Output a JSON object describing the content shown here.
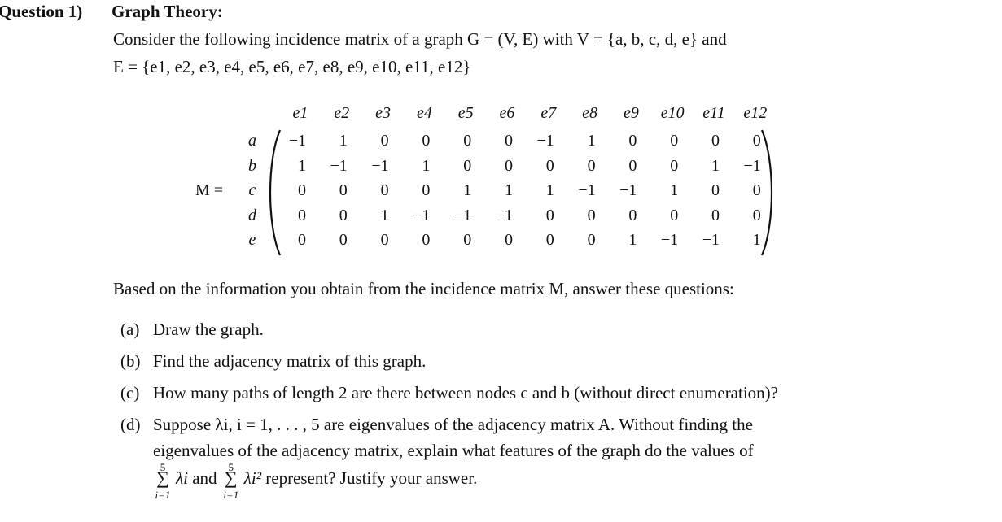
{
  "question": {
    "number": "Question 1)",
    "title": "Graph Theory:"
  },
  "intro": {
    "line1": "Consider the following incidence matrix of a graph G = (V, E) with V = {a, b, c, d, e} and",
    "line2": "E = {e1, e2, e3, e4, e5, e6, e7, e8, e9, e10, e11, e12}",
    "after_matrix": "Based on the information you obtain from the incidence matrix M, answer these questions:"
  },
  "matrix": {
    "name": "M =",
    "columns": [
      "e1",
      "e2",
      "e3",
      "e4",
      "e5",
      "e6",
      "e7",
      "e8",
      "e9",
      "e10",
      "e11",
      "e12"
    ],
    "rows": [
      {
        "label": "a",
        "values": [
          "−1",
          "1",
          "0",
          "0",
          "0",
          "0",
          "−1",
          "1",
          "0",
          "0",
          "0",
          "0"
        ]
      },
      {
        "label": "b",
        "values": [
          "1",
          "−1",
          "−1",
          "1",
          "0",
          "0",
          "0",
          "0",
          "0",
          "0",
          "1",
          "−1"
        ]
      },
      {
        "label": "c",
        "values": [
          "0",
          "0",
          "0",
          "0",
          "1",
          "1",
          "1",
          "−1",
          "−1",
          "1",
          "0",
          "0"
        ]
      },
      {
        "label": "d",
        "values": [
          "0",
          "0",
          "1",
          "−1",
          "−1",
          "−1",
          "0",
          "0",
          "0",
          "0",
          "0",
          "0"
        ]
      },
      {
        "label": "e",
        "values": [
          "0",
          "0",
          "0",
          "0",
          "0",
          "0",
          "0",
          "0",
          "1",
          "−1",
          "−1",
          "1"
        ]
      }
    ]
  },
  "questions": [
    {
      "label": "(a)",
      "text": "Draw the graph."
    },
    {
      "label": "(b)",
      "text": "Find the adjacency matrix of this graph."
    },
    {
      "label": "(c)",
      "text": "How many paths of length 2 are there between nodes c and b (without direct enumeration)?"
    },
    {
      "label": "(d)",
      "lines": [
        "Suppose λi,  i = 1, . . . , 5 are eigenvalues of the adjacency matrix A. Without finding the",
        "eigenvalues of the adjacency matrix, explain what features of the graph do the values of"
      ],
      "sum1": {
        "upper": "5",
        "lower": "i=1",
        "term": "λi"
      },
      "connector": "and",
      "sum2": {
        "upper": "5",
        "lower": "i=1",
        "term": "λi²"
      },
      "tail": "represent? Justify your answer."
    }
  ]
}
